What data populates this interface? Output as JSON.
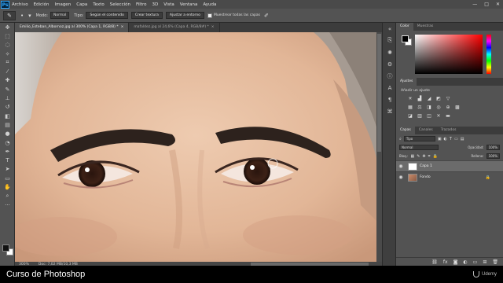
{
  "menubar": {
    "logo": "Ps",
    "items": [
      "Archivo",
      "Edición",
      "Imagen",
      "Capa",
      "Texto",
      "Selección",
      "Filtro",
      "3D",
      "Vista",
      "Ventana",
      "Ayuda"
    ],
    "window_controls": [
      "—",
      "□",
      "✕"
    ]
  },
  "options": {
    "mode_label": "Modo:",
    "mode_value": "Normal",
    "type_label": "Tipo:",
    "btn_content": "Según el contenido",
    "btn_texture": "Crear textura",
    "btn_adjust": "Ajustar a entorno",
    "sample_all_label": "Muestrear todas las capas"
  },
  "doc_tabs": [
    {
      "label": "Emilio_Esteban_Albornoz.jpg al 300% (Capa 1, RGB/8) *",
      "active": true
    },
    {
      "label": "mafaldez.jpg al 24,6% (Capa 4, RGB/8#) *",
      "active": false
    }
  ],
  "status": {
    "zoom": "300%",
    "doc": "Doc: 7,02 MB/10,3 MB"
  },
  "color_panel": {
    "tabs": [
      "Color",
      "Muestras"
    ]
  },
  "adjustments": {
    "tab": "Ajustes",
    "heading": "Añadir un ajuste"
  },
  "layers_panel": {
    "tabs": [
      "Capas",
      "Canales",
      "Trazados"
    ],
    "filter_value": "Tipo",
    "blend_mode": "Normal",
    "opacity_label": "Opacidad:",
    "opacity_value": "100%",
    "lock_label": "Bloq.:",
    "fill_label": "Relleno:",
    "fill_value": "100%",
    "layers": [
      {
        "name": "Capa 1",
        "selected": true
      },
      {
        "name": "Fondo",
        "selected": false
      }
    ]
  },
  "caption": {
    "title": "Curso de Photoshop",
    "brand": "Udemy"
  }
}
